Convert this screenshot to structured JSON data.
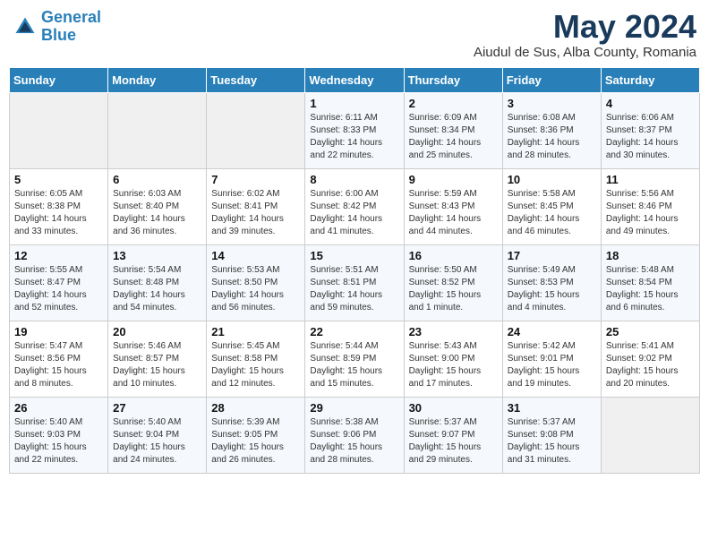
{
  "header": {
    "logo_line1": "General",
    "logo_line2": "Blue",
    "month": "May 2024",
    "location": "Aiudul de Sus, Alba County, Romania"
  },
  "days_of_week": [
    "Sunday",
    "Monday",
    "Tuesday",
    "Wednesday",
    "Thursday",
    "Friday",
    "Saturday"
  ],
  "weeks": [
    [
      {
        "day": "",
        "info": ""
      },
      {
        "day": "",
        "info": ""
      },
      {
        "day": "",
        "info": ""
      },
      {
        "day": "1",
        "info": "Sunrise: 6:11 AM\nSunset: 8:33 PM\nDaylight: 14 hours\nand 22 minutes."
      },
      {
        "day": "2",
        "info": "Sunrise: 6:09 AM\nSunset: 8:34 PM\nDaylight: 14 hours\nand 25 minutes."
      },
      {
        "day": "3",
        "info": "Sunrise: 6:08 AM\nSunset: 8:36 PM\nDaylight: 14 hours\nand 28 minutes."
      },
      {
        "day": "4",
        "info": "Sunrise: 6:06 AM\nSunset: 8:37 PM\nDaylight: 14 hours\nand 30 minutes."
      }
    ],
    [
      {
        "day": "5",
        "info": "Sunrise: 6:05 AM\nSunset: 8:38 PM\nDaylight: 14 hours\nand 33 minutes."
      },
      {
        "day": "6",
        "info": "Sunrise: 6:03 AM\nSunset: 8:40 PM\nDaylight: 14 hours\nand 36 minutes."
      },
      {
        "day": "7",
        "info": "Sunrise: 6:02 AM\nSunset: 8:41 PM\nDaylight: 14 hours\nand 39 minutes."
      },
      {
        "day": "8",
        "info": "Sunrise: 6:00 AM\nSunset: 8:42 PM\nDaylight: 14 hours\nand 41 minutes."
      },
      {
        "day": "9",
        "info": "Sunrise: 5:59 AM\nSunset: 8:43 PM\nDaylight: 14 hours\nand 44 minutes."
      },
      {
        "day": "10",
        "info": "Sunrise: 5:58 AM\nSunset: 8:45 PM\nDaylight: 14 hours\nand 46 minutes."
      },
      {
        "day": "11",
        "info": "Sunrise: 5:56 AM\nSunset: 8:46 PM\nDaylight: 14 hours\nand 49 minutes."
      }
    ],
    [
      {
        "day": "12",
        "info": "Sunrise: 5:55 AM\nSunset: 8:47 PM\nDaylight: 14 hours\nand 52 minutes."
      },
      {
        "day": "13",
        "info": "Sunrise: 5:54 AM\nSunset: 8:48 PM\nDaylight: 14 hours\nand 54 minutes."
      },
      {
        "day": "14",
        "info": "Sunrise: 5:53 AM\nSunset: 8:50 PM\nDaylight: 14 hours\nand 56 minutes."
      },
      {
        "day": "15",
        "info": "Sunrise: 5:51 AM\nSunset: 8:51 PM\nDaylight: 14 hours\nand 59 minutes."
      },
      {
        "day": "16",
        "info": "Sunrise: 5:50 AM\nSunset: 8:52 PM\nDaylight: 15 hours\nand 1 minute."
      },
      {
        "day": "17",
        "info": "Sunrise: 5:49 AM\nSunset: 8:53 PM\nDaylight: 15 hours\nand 4 minutes."
      },
      {
        "day": "18",
        "info": "Sunrise: 5:48 AM\nSunset: 8:54 PM\nDaylight: 15 hours\nand 6 minutes."
      }
    ],
    [
      {
        "day": "19",
        "info": "Sunrise: 5:47 AM\nSunset: 8:56 PM\nDaylight: 15 hours\nand 8 minutes."
      },
      {
        "day": "20",
        "info": "Sunrise: 5:46 AM\nSunset: 8:57 PM\nDaylight: 15 hours\nand 10 minutes."
      },
      {
        "day": "21",
        "info": "Sunrise: 5:45 AM\nSunset: 8:58 PM\nDaylight: 15 hours\nand 12 minutes."
      },
      {
        "day": "22",
        "info": "Sunrise: 5:44 AM\nSunset: 8:59 PM\nDaylight: 15 hours\nand 15 minutes."
      },
      {
        "day": "23",
        "info": "Sunrise: 5:43 AM\nSunset: 9:00 PM\nDaylight: 15 hours\nand 17 minutes."
      },
      {
        "day": "24",
        "info": "Sunrise: 5:42 AM\nSunset: 9:01 PM\nDaylight: 15 hours\nand 19 minutes."
      },
      {
        "day": "25",
        "info": "Sunrise: 5:41 AM\nSunset: 9:02 PM\nDaylight: 15 hours\nand 20 minutes."
      }
    ],
    [
      {
        "day": "26",
        "info": "Sunrise: 5:40 AM\nSunset: 9:03 PM\nDaylight: 15 hours\nand 22 minutes."
      },
      {
        "day": "27",
        "info": "Sunrise: 5:40 AM\nSunset: 9:04 PM\nDaylight: 15 hours\nand 24 minutes."
      },
      {
        "day": "28",
        "info": "Sunrise: 5:39 AM\nSunset: 9:05 PM\nDaylight: 15 hours\nand 26 minutes."
      },
      {
        "day": "29",
        "info": "Sunrise: 5:38 AM\nSunset: 9:06 PM\nDaylight: 15 hours\nand 28 minutes."
      },
      {
        "day": "30",
        "info": "Sunrise: 5:37 AM\nSunset: 9:07 PM\nDaylight: 15 hours\nand 29 minutes."
      },
      {
        "day": "31",
        "info": "Sunrise: 5:37 AM\nSunset: 9:08 PM\nDaylight: 15 hours\nand 31 minutes."
      },
      {
        "day": "",
        "info": ""
      }
    ]
  ]
}
